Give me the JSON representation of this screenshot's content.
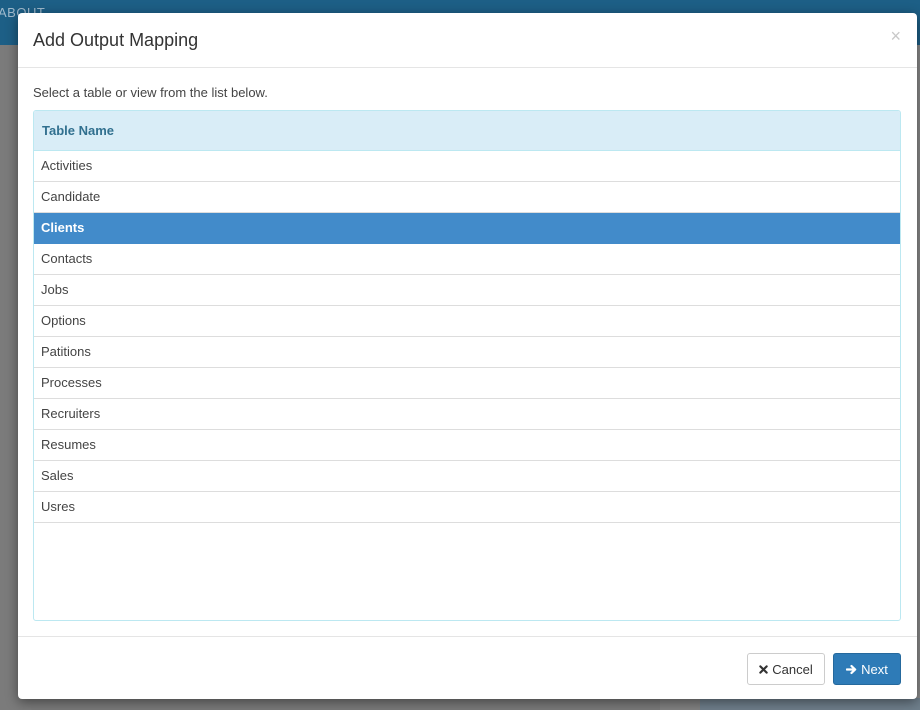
{
  "background": {
    "topbar_text": "ABOUT"
  },
  "modal": {
    "title": "Add Output Mapping",
    "close_glyph": "×",
    "instructions": "Select a table or view from the list below.",
    "table": {
      "header": "Table Name",
      "rows": [
        {
          "label": "Activities",
          "selected": false
        },
        {
          "label": "Candidate",
          "selected": false
        },
        {
          "label": "Clients",
          "selected": true
        },
        {
          "label": "Contacts",
          "selected": false
        },
        {
          "label": "Jobs",
          "selected": false
        },
        {
          "label": "Options",
          "selected": false
        },
        {
          "label": "Patitions",
          "selected": false
        },
        {
          "label": "Processes",
          "selected": false
        },
        {
          "label": "Recruiters",
          "selected": false
        },
        {
          "label": "Resumes",
          "selected": false
        },
        {
          "label": "Sales",
          "selected": false
        },
        {
          "label": "Usres",
          "selected": false
        }
      ]
    },
    "footer": {
      "cancel_label": "Cancel",
      "cancel_icon": "times-icon",
      "next_label": "Next",
      "next_icon": "arrow-right-icon"
    }
  },
  "colors": {
    "header_bg": "#d9edf7",
    "header_text": "#31708f",
    "selected_row": "#428bca",
    "primary_button": "#2e7bb7"
  }
}
